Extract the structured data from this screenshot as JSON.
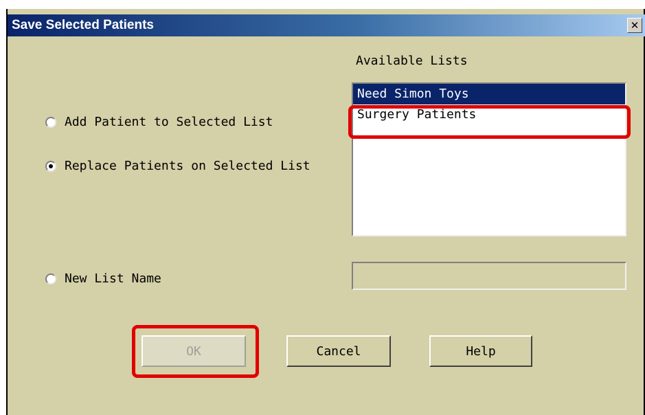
{
  "window": {
    "title": "Save Selected Patients",
    "close_glyph": "✕"
  },
  "options": {
    "add_label": "Add Patient to Selected List",
    "replace_label": "Replace Patients on Selected List",
    "new_label": "New List Name",
    "selected": "replace"
  },
  "available_lists": {
    "heading": "Available Lists",
    "items": [
      {
        "label": "Need Simon Toys",
        "selected": true
      },
      {
        "label": "Surgery Patients",
        "selected": false
      }
    ]
  },
  "new_list_name": {
    "value": "",
    "placeholder": ""
  },
  "buttons": {
    "ok": "OK",
    "cancel": "Cancel",
    "help": "Help",
    "ok_disabled": true
  },
  "colors": {
    "dialog_bg": "#d4d0a8",
    "title_start": "#0a246a",
    "selection": "#0a246a",
    "highlight": "#e00000"
  }
}
